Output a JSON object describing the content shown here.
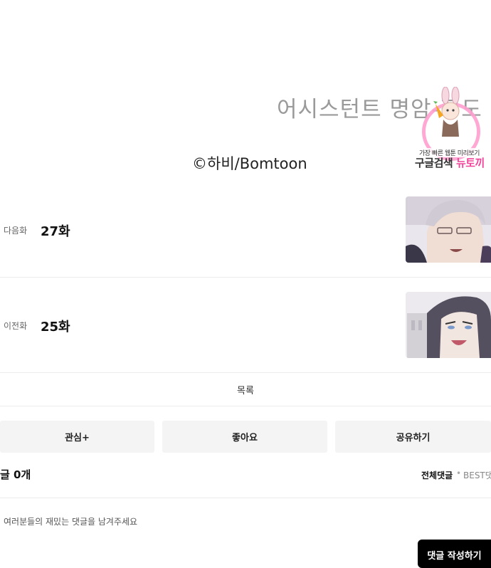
{
  "comic": {
    "end_text": "어시스턴트   명암-정도",
    "copyright": "©하비/Bomtoon"
  },
  "watermark": {
    "line1": "가장 빠른 웹툰 미리보기",
    "line2_a": "구글검색 ",
    "line2_b": "뉴토끼"
  },
  "next_episode": {
    "label": "다음화",
    "title": "27화"
  },
  "prev_episode": {
    "label": "이전화",
    "title": "25화"
  },
  "list_button": "목록",
  "actions": {
    "interest": "관심+",
    "like": "좋아요",
    "share": "공유하기"
  },
  "comments": {
    "count_label": "글 0개",
    "sort_all": "전체댓글",
    "sort_dot": "•",
    "sort_best": "BEST댓",
    "placeholder": "여러분들의 재밌는 댓글을 남겨주세요",
    "write_button": "댓글 작성하기"
  },
  "colors": {
    "accent": "#000000",
    "watermark_pink": "#f0449a"
  }
}
